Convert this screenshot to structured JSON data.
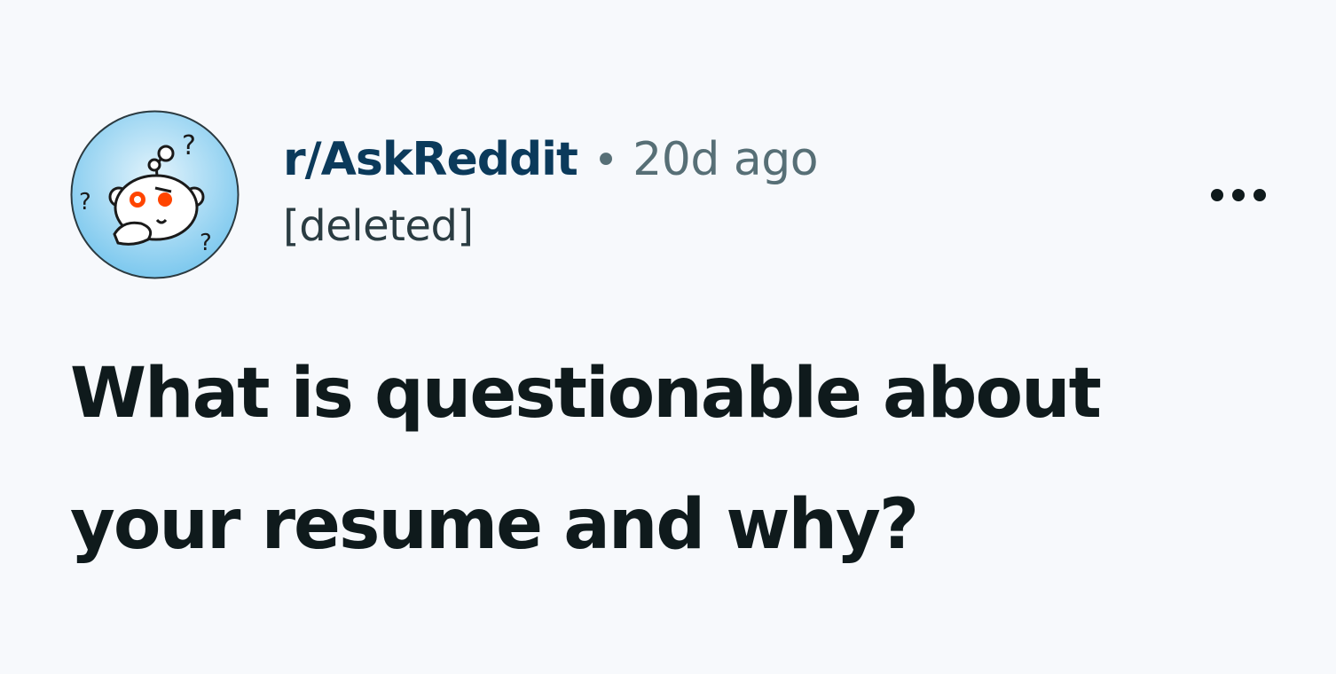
{
  "post": {
    "subreddit": "r/AskReddit",
    "separator": "•",
    "time": "20d ago",
    "author": "[deleted]",
    "title_line1": "What is questionable about",
    "title_line2": "your resume and why?"
  },
  "avatar": {
    "icon": "snoo-question-icon",
    "colors": {
      "background": "#cfeaf7",
      "eyes": "#ff4500"
    }
  },
  "menu": {
    "icon": "more-options-icon"
  }
}
